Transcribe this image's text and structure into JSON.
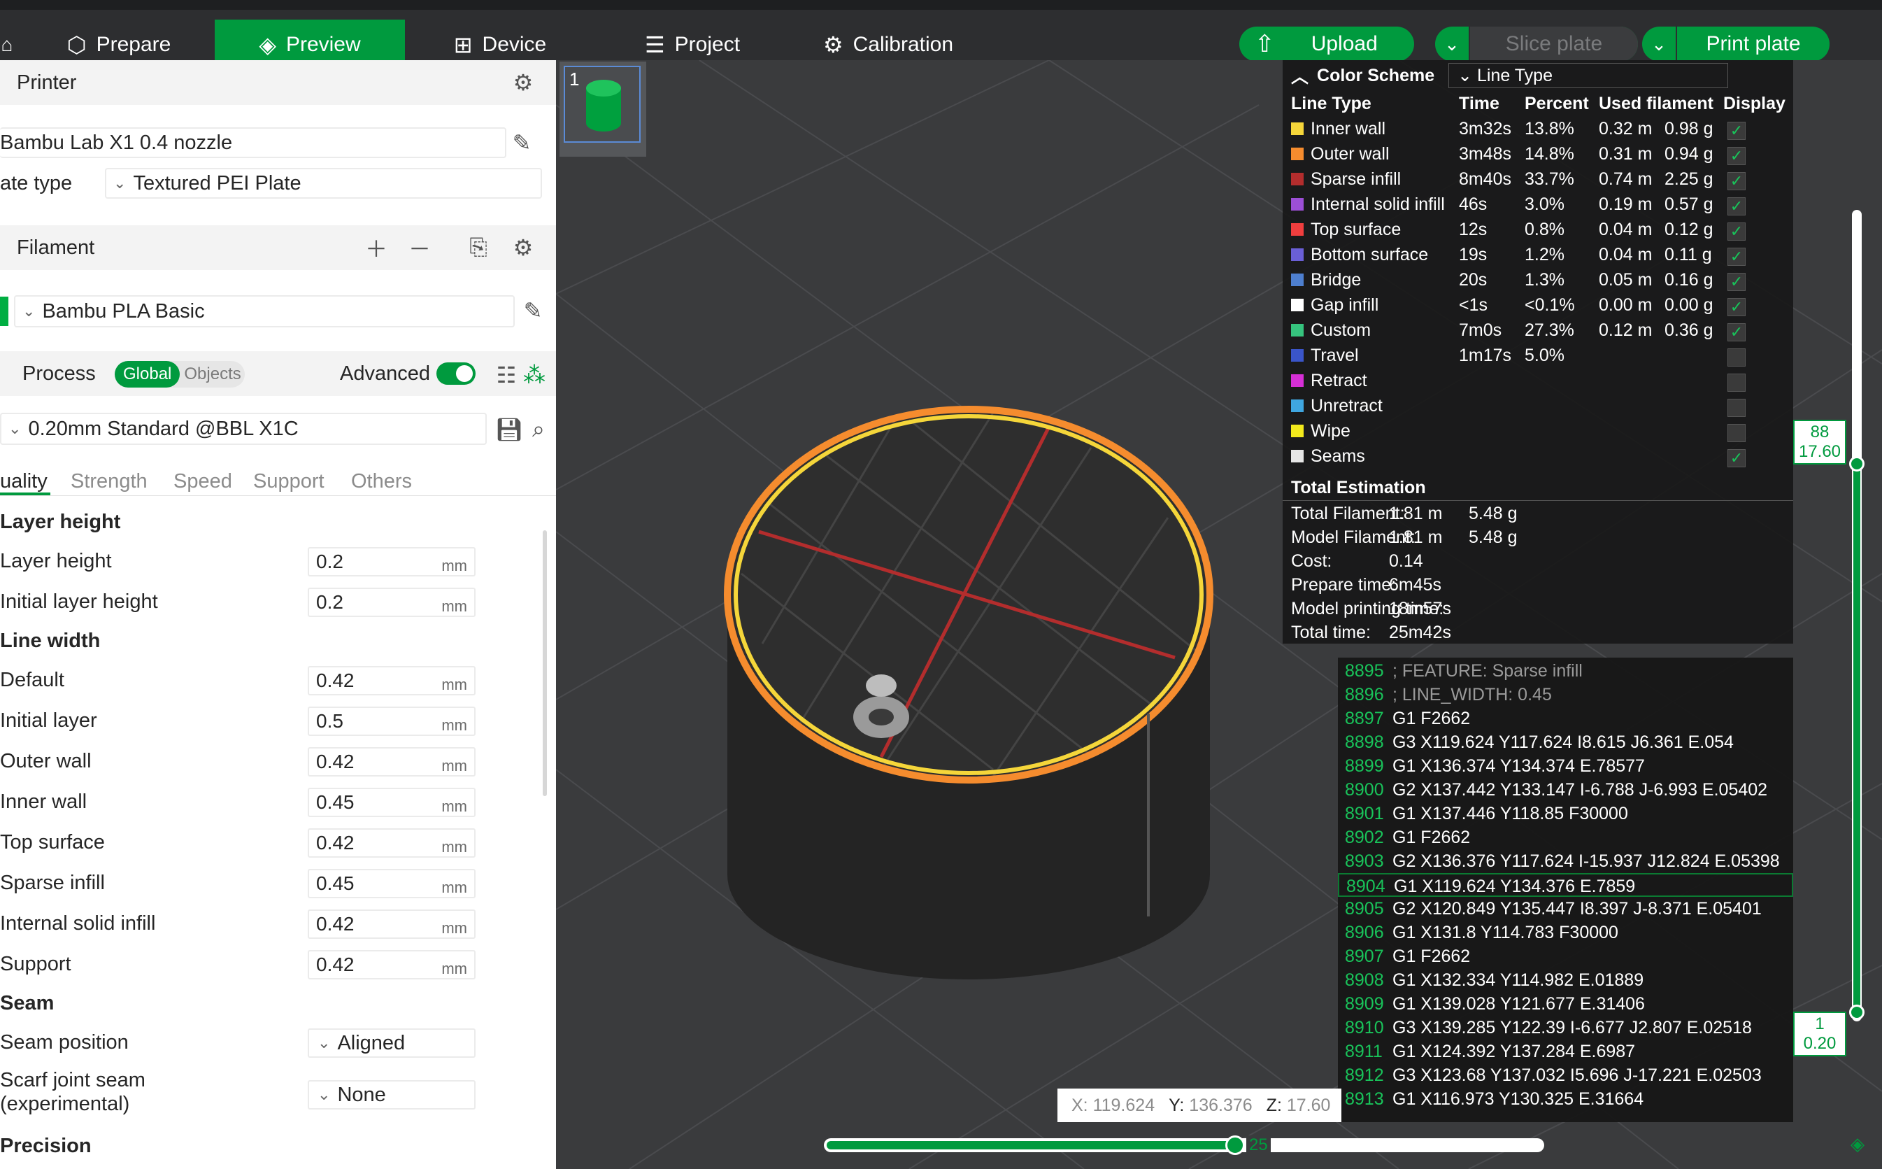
{
  "topbar": {
    "tabs": [
      {
        "label": "Prepare",
        "icon": "cube-icon"
      },
      {
        "label": "Preview",
        "icon": "layers-icon"
      },
      {
        "label": "Device",
        "icon": "device-icon"
      },
      {
        "label": "Project",
        "icon": "project-icon"
      },
      {
        "label": "Calibration",
        "icon": "gear-icon"
      }
    ],
    "active_tab": "Preview",
    "upload_label": "Upload",
    "slice_label": "Slice plate",
    "print_label": "Print plate",
    "accent": "#009a3e"
  },
  "printer": {
    "section_title": "Printer",
    "name": "Bambu Lab X1 0.4 nozzle",
    "plate_label": "ate type",
    "plate_value": "Textured PEI Plate"
  },
  "filament": {
    "section_title": "Filament",
    "item": "Bambu PLA Basic",
    "color": "#00ae42"
  },
  "process": {
    "section_title": "Process",
    "global_label": "Global",
    "objects_label": "Objects",
    "advanced_label": "Advanced",
    "advanced_on": true,
    "profile": "0.20mm Standard @BBL X1C",
    "tabs": [
      "uality",
      "Strength",
      "Speed",
      "Support",
      "Others"
    ],
    "active_tab": "uality"
  },
  "quality": {
    "layer_height_group": "Layer height",
    "layer_height_label": "Layer height",
    "layer_height": "0.2",
    "initial_layer_height_label": "Initial layer height",
    "initial_layer_height": "0.2",
    "line_width_group": "Line width",
    "line_widths": [
      {
        "label": "Default",
        "value": "0.42"
      },
      {
        "label": "Initial layer",
        "value": "0.5"
      },
      {
        "label": "Outer wall",
        "value": "0.42"
      },
      {
        "label": "Inner wall",
        "value": "0.45"
      },
      {
        "label": "Top surface",
        "value": "0.42"
      },
      {
        "label": "Sparse infill",
        "value": "0.45"
      },
      {
        "label": "Internal solid infill",
        "value": "0.42"
      },
      {
        "label": "Support",
        "value": "0.42"
      }
    ],
    "unit": "mm",
    "seam_group": "Seam",
    "seam_position_label": "Seam position",
    "seam_position": "Aligned",
    "scarf_label_1": "Scarf joint seam",
    "scarf_label_2": "(experimental)",
    "scarf_value": "None",
    "precision_group": "Precision"
  },
  "viewport": {
    "plate_number": "1",
    "legend": {
      "scheme_label": "Color Scheme",
      "scheme_value": "Line Type",
      "headers": [
        "Line Type",
        "Time",
        "Percent",
        "Used filament",
        "Display"
      ],
      "rows": [
        {
          "name": "Inner wall",
          "color": "#f5d63a",
          "time": "3m32s",
          "percent": "13.8%",
          "length": "0.32 m",
          "weight": "0.98 g",
          "shown": true
        },
        {
          "name": "Outer wall",
          "color": "#f58c2e",
          "time": "3m48s",
          "percent": "14.8%",
          "length": "0.31 m",
          "weight": "0.94 g",
          "shown": true
        },
        {
          "name": "Sparse infill",
          "color": "#b32d2d",
          "time": "8m40s",
          "percent": "33.7%",
          "length": "0.74 m",
          "weight": "2.25 g",
          "shown": true
        },
        {
          "name": "Internal solid infill",
          "color": "#9c4fd6",
          "time": "46s",
          "percent": "3.0%",
          "length": "0.19 m",
          "weight": "0.57 g",
          "shown": true
        },
        {
          "name": "Top surface",
          "color": "#f03e3e",
          "time": "12s",
          "percent": "0.8%",
          "length": "0.04 m",
          "weight": "0.12 g",
          "shown": true
        },
        {
          "name": "Bottom surface",
          "color": "#6a5fd6",
          "time": "19s",
          "percent": "1.2%",
          "length": "0.04 m",
          "weight": "0.11 g",
          "shown": true
        },
        {
          "name": "Bridge",
          "color": "#4e7fcf",
          "time": "20s",
          "percent": "1.3%",
          "length": "0.05 m",
          "weight": "0.16 g",
          "shown": true
        },
        {
          "name": "Gap infill",
          "color": "#ffffff",
          "time": "<1s",
          "percent": "<0.1%",
          "length": "0.00 m",
          "weight": "0.00 g",
          "shown": true
        },
        {
          "name": "Custom",
          "color": "#36c47e",
          "time": "7m0s",
          "percent": "27.3%",
          "length": "0.12 m",
          "weight": "0.36 g",
          "shown": true
        },
        {
          "name": "Travel",
          "color": "#3a55c9",
          "time": "1m17s",
          "percent": "5.0%",
          "length": "",
          "weight": "",
          "shown": false
        },
        {
          "name": "Retract",
          "color": "#d62fd6",
          "time": "",
          "percent": "",
          "length": "",
          "weight": "",
          "shown": false
        },
        {
          "name": "Unretract",
          "color": "#3fa6e0",
          "time": "",
          "percent": "",
          "length": "",
          "weight": "",
          "shown": false
        },
        {
          "name": "Wipe",
          "color": "#f2e91c",
          "time": "",
          "percent": "",
          "length": "",
          "weight": "",
          "shown": false
        },
        {
          "name": "Seams",
          "color": "#e6e6e6",
          "time": "",
          "percent": "",
          "length": "",
          "weight": "",
          "shown": true
        }
      ],
      "estimation_title": "Total Estimation",
      "estimation": [
        {
          "label": "Total Filament:",
          "v1": "1.81 m",
          "v2": "5.48 g"
        },
        {
          "label": "Model Filament:",
          "v1": "1.81 m",
          "v2": "5.48 g"
        },
        {
          "label": "Cost:",
          "v1": "0.14",
          "v2": ""
        },
        {
          "label": "Prepare time:",
          "v1": "6m45s",
          "v2": ""
        },
        {
          "label": "Model printing time:",
          "v1": "18m57s",
          "v2": ""
        },
        {
          "label": "Total time:",
          "v1": "25m42s",
          "v2": ""
        }
      ]
    },
    "gcode": [
      {
        "n": "8895",
        "t": "; FEATURE: Sparse infill",
        "comment": true
      },
      {
        "n": "8896",
        "t": "; LINE_WIDTH: 0.45",
        "comment": true
      },
      {
        "n": "8897",
        "t": "G1 F2662"
      },
      {
        "n": "8898",
        "t": "G3 X119.624 Y117.624 I8.615 J6.361 E.054"
      },
      {
        "n": "8899",
        "t": "G1 X136.374 Y134.374 E.78577"
      },
      {
        "n": "8900",
        "t": "G2 X137.442 Y133.147 I-6.788 J-6.993 E.05402"
      },
      {
        "n": "8901",
        "t": "G1 X137.446 Y118.85 F30000"
      },
      {
        "n": "8902",
        "t": "G1 F2662"
      },
      {
        "n": "8903",
        "t": "G2 X136.376 Y117.624 I-15.937 J12.824 E.05398"
      },
      {
        "n": "8904",
        "t": "G1 X119.624 Y134.376 E.7859",
        "highlight": true
      },
      {
        "n": "8905",
        "t": "G2 X120.849 Y135.447 I8.397 J-8.371 E.05401"
      },
      {
        "n": "8906",
        "t": "G1 X131.8 Y114.783 F30000"
      },
      {
        "n": "8907",
        "t": "G1 F2662"
      },
      {
        "n": "8908",
        "t": "G1 X132.334 Y114.982 E.01889"
      },
      {
        "n": "8909",
        "t": "G1 X139.028 Y121.677 E.31406"
      },
      {
        "n": "8910",
        "t": "G3 X139.285 Y122.39 I-6.677 J2.807 E.02518"
      },
      {
        "n": "8911",
        "t": "G1 X124.392 Y137.284 E.6987"
      },
      {
        "n": "8912",
        "t": "G3 X123.68 Y137.032 I5.696 J-17.221 E.02503"
      },
      {
        "n": "8913",
        "t": "G1 X116.973 Y130.325 E.31664"
      }
    ],
    "coords": {
      "x_label": "X:",
      "x": "119.624",
      "y_label": "Y:",
      "y": "136.376",
      "z_label": "Z:",
      "z": "17.60"
    },
    "layer_top": {
      "layer": "88",
      "height": "17.60"
    },
    "layer_bottom": {
      "layer": "1",
      "height": "0.20"
    },
    "move_index": "25"
  }
}
